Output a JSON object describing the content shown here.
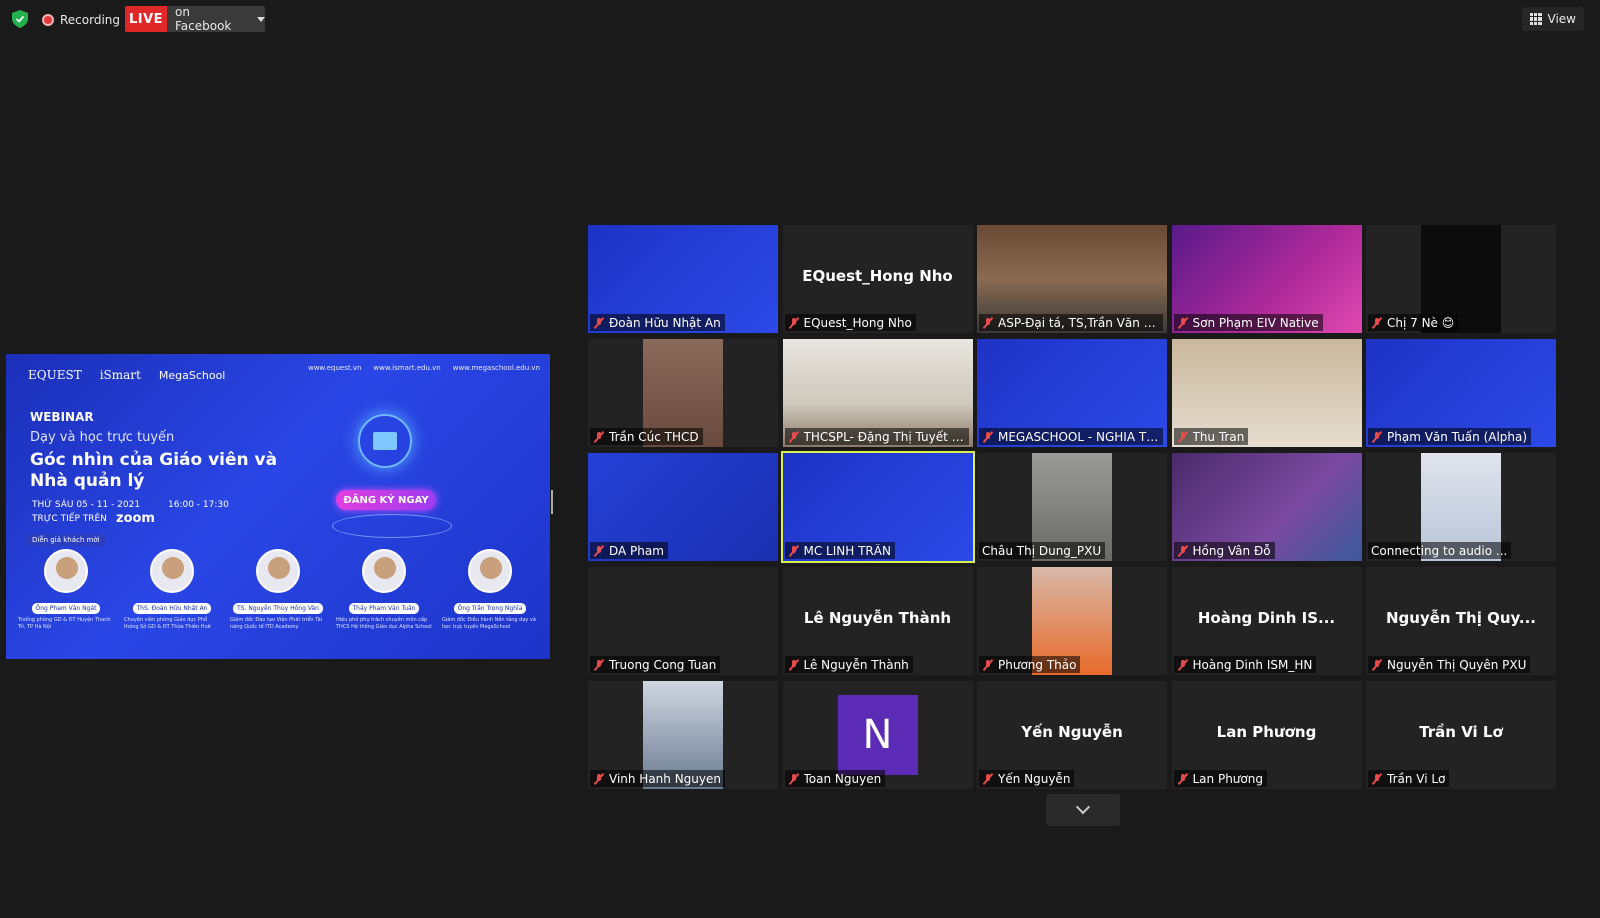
{
  "topbar": {
    "recording_label": "Recording",
    "live_badge": "LIVE",
    "live_destination": "on Facebook",
    "view_label": "View"
  },
  "colors": {
    "background": "#1a1a1a",
    "live_red": "#e02828",
    "active_speaker_outline": "#d8f050",
    "muted_mic": "#e74c4c"
  },
  "shared_screen": {
    "logos": [
      "EQUEST",
      "iSmart",
      "MegaSchool"
    ],
    "urls": [
      "www.equest.vn",
      "www.ismart.edu.vn",
      "www.megaschool.edu.vn"
    ],
    "heading": "WEBINAR",
    "subheading": "Dạy và học trực tuyến",
    "title": "Góc nhìn của Giáo viên và Nhà quản lý",
    "date": "THỨ SÁU 05 - 11 - 2021",
    "time": "16:00 - 17:30",
    "live_on": "TRỰC TIẾP TRÊN",
    "platform": "zoom",
    "guests_label": "Diễn giả khách mời",
    "cta": "ĐĂNG KÝ NGAY",
    "speakers": [
      {
        "name": "Ông Phạm Văn Ngát",
        "desc": "Trưởng phòng GD & ĐT Huyện Thanh Trì, TP Hà Nội"
      },
      {
        "name": "ThS. Đoàn Hữu Nhật An",
        "desc": "Chuyên viên phòng Giáo dục Phổ thông Sở GD & ĐT Thừa Thiên Huế"
      },
      {
        "name": "TS. Nguyễn Thùy Hồng Vân",
        "desc": "Giám đốc Đào tạo Viện Phát triển Tài năng Quốc tế ITD Academy"
      },
      {
        "name": "Thầy Phạm Văn Tuấn",
        "desc": "Hiệu phó phụ trách chuyên môn cấp THCS Hệ thống Giáo dục Alpha School"
      },
      {
        "name": "Ông Trần Trọng Nghĩa",
        "desc": "Giám đốc Điều hành Nền tảng dạy và học trực tuyến MegaSchool"
      }
    ]
  },
  "participants": [
    {
      "name": "Đoàn Hữu Nhật An",
      "muted": true,
      "video": "webinar"
    },
    {
      "name": "EQuest_Hong Nho",
      "muted": true,
      "center": "EQuest_Hong Nho"
    },
    {
      "name": "ASP-Đại tá, TS,Trần Văn Th...",
      "muted": true,
      "video": "office"
    },
    {
      "name": "Sơn Phạm EIV Native",
      "muted": true,
      "video": "eiv"
    },
    {
      "name": "Chị 7 Nè 😊",
      "muted": true,
      "video": "dark"
    },
    {
      "name": "Trần Cúc THCD",
      "muted": true,
      "video": "blur"
    },
    {
      "name": "THCSPL- Đặng Thị Tuyết N...",
      "muted": true,
      "video": "room"
    },
    {
      "name": "MEGASCHOOL - NGHIA TR...",
      "muted": true,
      "video": "webinar"
    },
    {
      "name": "Thu Tran",
      "muted": true,
      "video": "shelf"
    },
    {
      "name": "Phạm Văn Tuấn (Alpha)",
      "muted": true,
      "video": "webinar"
    },
    {
      "name": "DA Pham",
      "muted": true,
      "video": "webinar2"
    },
    {
      "name": "MC LINH TRẦN",
      "muted": true,
      "video": "webinar",
      "active": true
    },
    {
      "name": "Châu Thị Dung_PXU",
      "muted": false,
      "video": "ceiling"
    },
    {
      "name": "Hồng Vân Đỗ",
      "muted": true,
      "video": "class"
    },
    {
      "name": "Connecting to audio ...",
      "muted": false,
      "video": "map"
    },
    {
      "name": "Truong Cong Tuan",
      "muted": true
    },
    {
      "name": "Lê Nguyễn Thành",
      "muted": true,
      "center": "Lê Nguyễn Thành"
    },
    {
      "name": "Phương Thảo",
      "muted": true,
      "video": "photo"
    },
    {
      "name": "Hoàng Dinh ISM_HN",
      "muted": true,
      "center": "Hoàng Dinh IS..."
    },
    {
      "name": "Nguyễn Thị Quyên PXU",
      "muted": true,
      "center": "Nguyễn Thị Quy..."
    },
    {
      "name": "Vinh Hanh Nguyen",
      "muted": true,
      "video": "portrait"
    },
    {
      "name": "Toan Nguyen",
      "muted": true,
      "avatar": "N"
    },
    {
      "name": "Yến Nguyễn",
      "muted": true,
      "center": "Yến Nguyễn"
    },
    {
      "name": "Lan Phương",
      "muted": true,
      "center": "Lan Phương"
    },
    {
      "name": "Trần Vi Lơ",
      "muted": true,
      "center": "Trần Vi Lơ"
    }
  ]
}
